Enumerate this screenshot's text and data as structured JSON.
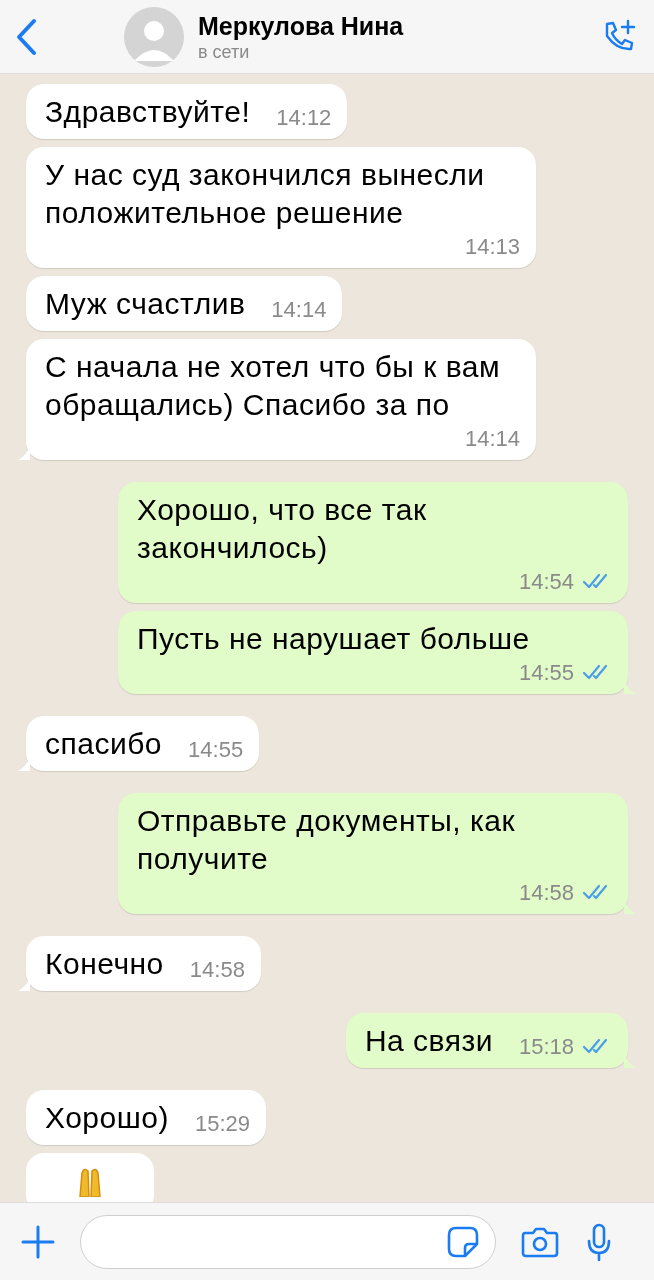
{
  "header": {
    "name": "Меркулова Нина",
    "status": "в сети"
  },
  "messages": [
    {
      "kind": "text",
      "outgoing": false,
      "text": "Здравствуйте!",
      "time": "14:12"
    },
    {
      "kind": "text",
      "outgoing": false,
      "text": "У нас суд закончился вынесли положительное решение",
      "time": "14:13"
    },
    {
      "kind": "text",
      "outgoing": false,
      "text": "Муж счастлив",
      "time": "14:14"
    },
    {
      "kind": "text",
      "outgoing": false,
      "text": "С начала не хотел что бы к вам обращались) Спасибо за по",
      "time": "14:14"
    },
    {
      "kind": "text",
      "outgoing": true,
      "text": "Хорошо, что все так закончилось)",
      "time": "14:54",
      "read": true
    },
    {
      "kind": "text",
      "outgoing": true,
      "text": "Пусть не нарушает больше",
      "time": "14:55",
      "read": true
    },
    {
      "kind": "text",
      "outgoing": false,
      "text": "спасибо",
      "time": "14:55"
    },
    {
      "kind": "text",
      "outgoing": true,
      "text": "Отправьте документы, как получите",
      "time": "14:58",
      "read": true
    },
    {
      "kind": "text",
      "outgoing": false,
      "text": "Конечно",
      "time": "14:58"
    },
    {
      "kind": "text",
      "outgoing": true,
      "text": "На связи",
      "time": "15:18",
      "read": true
    },
    {
      "kind": "text",
      "outgoing": false,
      "text": "Хорошо)",
      "time": "15:29"
    },
    {
      "kind": "emoji",
      "outgoing": false
    }
  ]
}
